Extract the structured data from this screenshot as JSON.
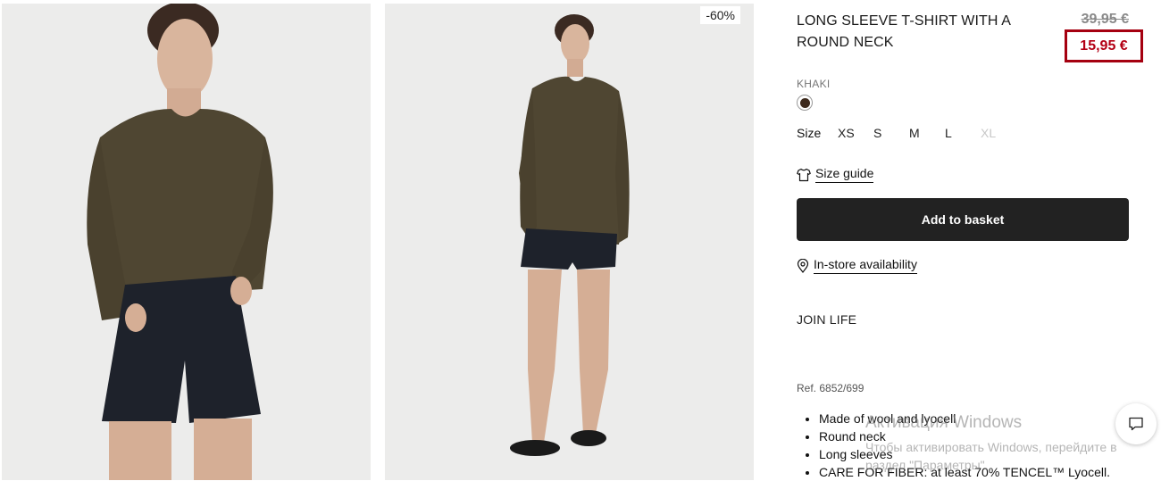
{
  "product": {
    "badge": "-60%",
    "title": "LONG SLEEVE T-SHIRT WITH A ROUND NECK",
    "old_price": "39,95 €",
    "new_price": "15,95 €",
    "color_name": "KHAKI",
    "swatch_color": "#3d2a1d",
    "size_label": "Size",
    "sizes": [
      "XS",
      "S",
      "M",
      "L",
      "XL"
    ],
    "unavailable_size": "XL",
    "size_guide": "Size guide",
    "add_to_basket": "Add to basket",
    "in_store": "In-store availability",
    "join_life": "JOIN LIFE",
    "ref": "Ref. 6852/699",
    "features": [
      "Made of wool and lyocell",
      "Round neck",
      "Long sleeves",
      "CARE FOR FIBER: at least 70% TENCEL™ Lyocell."
    ]
  },
  "colors": {
    "accent_red": "#b30015",
    "button_dark": "#222222",
    "shirt_khaki": "#4f4632"
  },
  "icons": [
    "tshirt-icon",
    "location-pin-icon",
    "chat-icon"
  ],
  "watermark": {
    "line1": "Активация Windows",
    "line2": "Чтобы активировать Windows, перейдите в раздел \"Параметры\"."
  }
}
